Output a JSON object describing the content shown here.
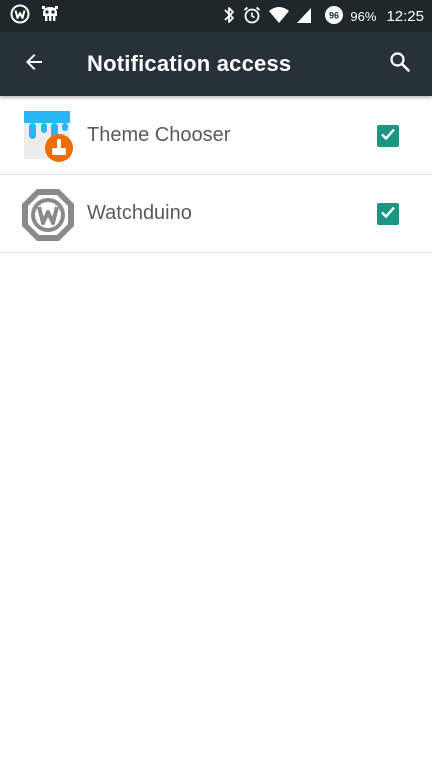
{
  "status_bar": {
    "battery_percent": "96%",
    "time": "12:25",
    "badge_number": "96",
    "left_icons": [
      "watchduino-notification-icon",
      "cyanogen-mascot-icon"
    ],
    "right_icons": [
      "bluetooth-icon",
      "alarm-icon",
      "wifi-icon",
      "cell-signal-icon",
      "battery-badge-icon"
    ]
  },
  "app_bar": {
    "title": "Notification access",
    "back_icon": "arrow-back-icon",
    "search_icon": "search-icon"
  },
  "items": [
    {
      "label": "Theme Chooser",
      "icon": "theme-chooser-icon",
      "checked": true
    },
    {
      "label": "Watchduino",
      "icon": "watchduino-icon",
      "checked": true
    }
  ],
  "colors": {
    "status_bar": "#1e272c",
    "app_bar": "#263238",
    "checkbox": "#1a9683",
    "label_text": "#5a5a5a",
    "divider": "#e3e3e3"
  }
}
